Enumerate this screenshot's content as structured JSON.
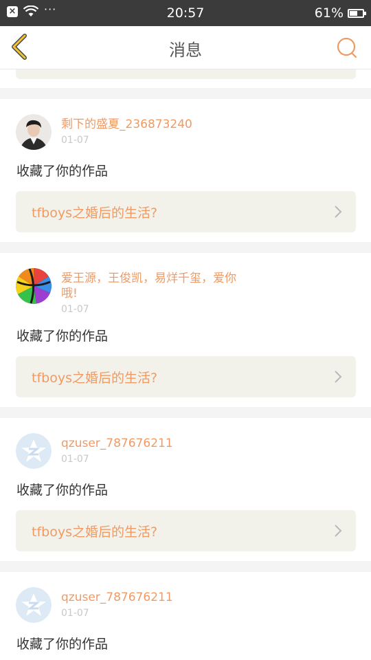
{
  "status_bar": {
    "time": "20:57",
    "battery": "61%",
    "battery_level": 0.61,
    "notif_icon": "close-icon",
    "dots": "···"
  },
  "nav": {
    "title": "消息",
    "back_icon": "chevron-left-icon",
    "search_icon": "search-icon",
    "accent": "#f4c430",
    "search_color": "#ef9a64"
  },
  "messages": [
    {
      "username": "剩下的盛夏_236873240",
      "date": "01-07",
      "action": "收藏了你的作品",
      "work_title": "tfboys之婚后的生活?",
      "avatar": "photo-avatar"
    },
    {
      "username": "爱王源，王俊凯，易烊千玺，爱你哦!",
      "date": "01-07",
      "action": "收藏了你的作品",
      "work_title": "tfboys之婚后的生活?",
      "avatar": "rainbow-ball-avatar"
    },
    {
      "username": "qzuser_787676211",
      "date": "01-07",
      "action": "收藏了你的作品",
      "work_title": "tfboys之婚后的生活?",
      "avatar": "qzone-default-avatar"
    },
    {
      "username": "qzuser_787676211",
      "date": "01-07",
      "action": "收藏了你的作品",
      "work_title": "",
      "avatar": "qzone-default-avatar"
    }
  ],
  "colors": {
    "username": "#ef9a64",
    "link_bg": "#f3f2ea",
    "status_bar_bg": "#3b3b3b"
  }
}
